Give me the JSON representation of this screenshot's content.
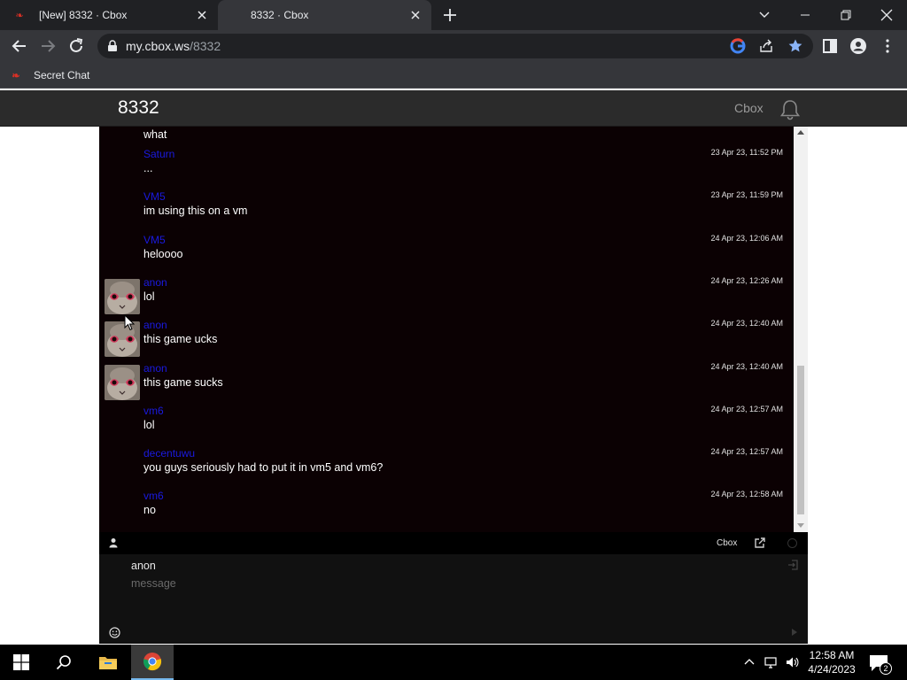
{
  "browser": {
    "tabs": [
      {
        "title": "[New] 8332 · Cbox",
        "favicon": "cbox-favicon-icon"
      },
      {
        "title": "8332 · Cbox",
        "favicon": "none"
      }
    ],
    "url_host": "my.cbox.ws",
    "url_path": "/8332",
    "bookmarks": [
      {
        "label": "Secret Chat",
        "favicon": "cbox-favicon-icon"
      }
    ]
  },
  "page": {
    "title": "8332",
    "brand": "Cbox"
  },
  "chat": {
    "partial_top_text": "what",
    "messages": [
      {
        "user": "Saturn",
        "time": "23 Apr 23, 11:52 PM",
        "text": "...",
        "avatar": false
      },
      {
        "user": "VM5",
        "time": "23 Apr 23, 11:59 PM",
        "text": "im using this on a vm",
        "avatar": false
      },
      {
        "user": "VM5",
        "time": "24 Apr 23, 12:06 AM",
        "text": "heloooo",
        "avatar": false
      },
      {
        "user": "anon",
        "time": "24 Apr 23, 12:26 AM",
        "text": "lol",
        "avatar": true
      },
      {
        "user": "anon",
        "time": "24 Apr 23, 12:40 AM",
        "text": "this game ucks",
        "avatar": true
      },
      {
        "user": "anon",
        "time": "24 Apr 23, 12:40 AM",
        "text": "this game sucks",
        "avatar": true
      },
      {
        "user": "vm6",
        "time": "24 Apr 23, 12:57 AM",
        "text": "lol",
        "avatar": false
      },
      {
        "user": "decentuwu",
        "time": "24 Apr 23, 12:57 AM",
        "text": "you guys seriously had to put it in vm5 and vm6?",
        "avatar": false
      },
      {
        "user": "vm6",
        "time": "24 Apr 23, 12:58 AM",
        "text": "no",
        "avatar": false
      }
    ],
    "footer_link": "Cbox",
    "compose": {
      "name_value": "anon",
      "message_placeholder": "message"
    }
  },
  "taskbar": {
    "time": "12:58 AM",
    "date": "4/24/2023",
    "notification_count": "2"
  },
  "colors": {
    "chat_bg": "#0b0103",
    "username": "#1a1ae0",
    "page_header": "#2b2b2b",
    "chrome_dark": "#202124",
    "chrome_toolbar": "#35363a"
  }
}
